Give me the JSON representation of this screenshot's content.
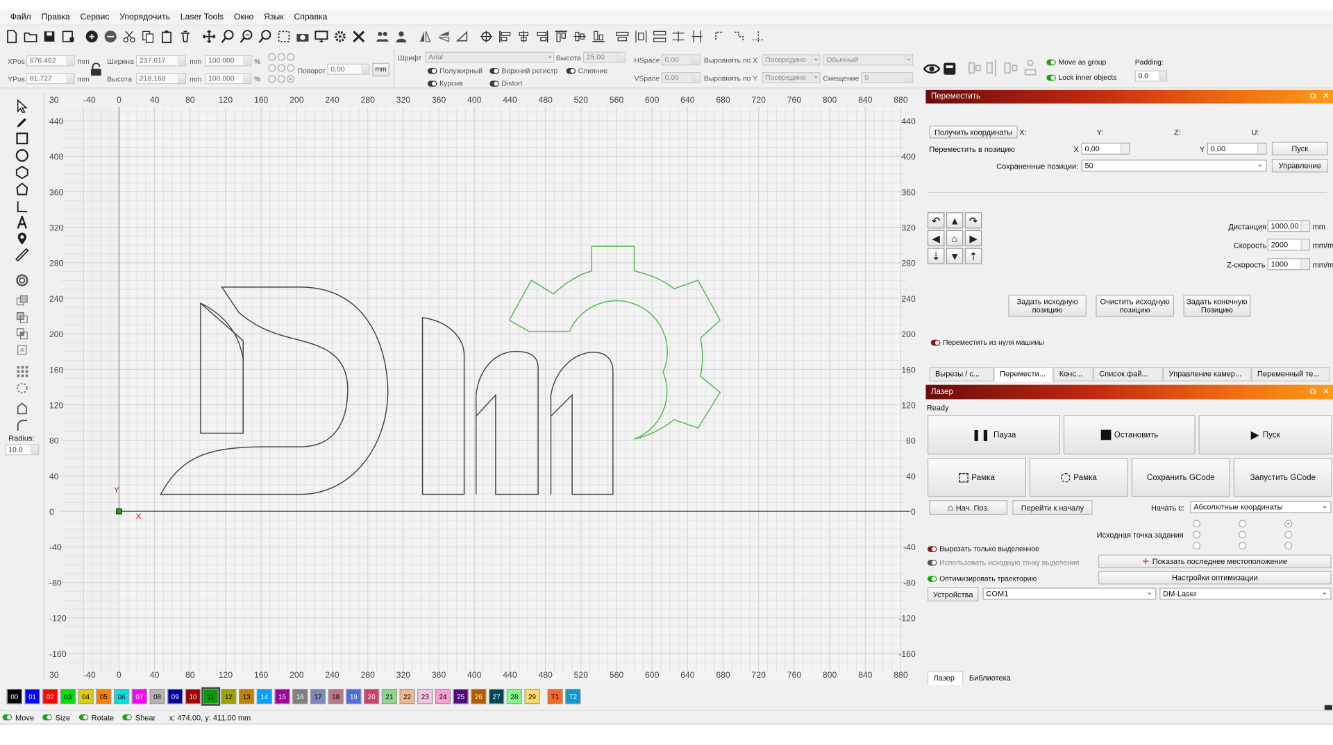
{
  "menu": [
    "Файл",
    "Правка",
    "Сервис",
    "Упорядочить",
    "Laser Tools",
    "Окно",
    "Язык",
    "Справка"
  ],
  "toolbar_icons": [
    "new-file-icon",
    "open-folder-icon",
    "save-icon",
    "save-as-icon",
    "import-icon",
    "export-icon",
    "cut-icon",
    "copy-icon",
    "paste-icon",
    "delete-icon",
    "move-icon",
    "zoom-in-icon",
    "zoom-out-icon",
    "zoom-fit-icon",
    "zoom-frame-icon",
    "camera-icon",
    "monitor-icon",
    "settings-icon",
    "tools-icon",
    "users-icon",
    "user-icon",
    "mirror-h-icon",
    "mirror-v-icon",
    "rotate-icon",
    "target-icon",
    "align-left-icon",
    "align-center-icon",
    "align-right-icon",
    "align-top-icon",
    "align-middle-icon",
    "align-bottom-icon",
    "distribute-h-icon",
    "distribute-v-icon",
    "distribute-icon",
    "spacing-icon",
    "spacing-v-icon",
    "corner-icon",
    "step-icon",
    "snap-icon"
  ],
  "props": {
    "xpos_label": "XPos",
    "xpos": "676.462",
    "ypos_label": "YPos",
    "ypos": "81.727",
    "width_label": "Ширина",
    "width": "237.617",
    "height_label": "Высота",
    "height": "218.168",
    "unit": "mm",
    "scale_w": "100.000",
    "scale_h": "100.000",
    "pct": "%",
    "rotate_label": "Поворот",
    "rotate": "0,00",
    "mm_btn": "mm",
    "font_label": "Шрифт",
    "font": "Arial",
    "font_h_label": "Высота",
    "font_h": "25.00",
    "bold": "Полужирный",
    "upper": "Верхний регистр",
    "weld": "Слияние",
    "italic": "Курсив",
    "distort": "Distort",
    "hspace_label": "HSpace",
    "hspace": "0.00",
    "vspace_label": "VSpace",
    "vspace": "0.00",
    "alignx_label": "Выровнять по X",
    "alignx": "Посередине",
    "aligny_label": "Выровнять по Y",
    "aligny": "Посередине",
    "normal": "Обычный",
    "offset_label": "Смещение",
    "offset": "0",
    "move_group": "Move as group",
    "lock_inner": "Lock inner objects",
    "padding_label": "Padding:",
    "padding": "0.0"
  },
  "left": {
    "radius_label": "Radius:",
    "radius": "10.0"
  },
  "ruler": {
    "top": [
      "30",
      "-40",
      "0",
      "40",
      "80",
      "120",
      "160",
      "200",
      "240",
      "280",
      "320",
      "360",
      "400",
      "440",
      "480",
      "520",
      "560",
      "600",
      "640",
      "680",
      "720",
      "760",
      "800",
      "840",
      "880"
    ],
    "left": [
      "440",
      "400",
      "360",
      "320",
      "280",
      "240",
      "200",
      "160",
      "120",
      "80",
      "40",
      "0",
      "-40",
      "-80",
      "-120",
      "-160"
    ]
  },
  "move_panel": {
    "title": "Переместить",
    "get_coords": "Получить координаты",
    "x": "X:",
    "y": "Y:",
    "z": "Z:",
    "u": "U:",
    "move_to": "Переместить в позицию",
    "xl": "X",
    "xv": "0,00",
    "yl": "Y",
    "yv": "0,00",
    "go": "Пуск",
    "saved_label": "Сохраненные позиции:",
    "saved": "50",
    "manage": "Управление",
    "distance_label": "Дистанция",
    "distance": "1000,00",
    "distance_unit": "mm",
    "speed_label": "Скорость",
    "speed": "2000",
    "speed_unit": "mm/m",
    "zspeed_label": "Z-скорость",
    "zspeed": "1000",
    "zspeed_unit": "mm/m",
    "set_origin": "Задать исходную позицию",
    "clear_origin": "Очистить исходную позицию",
    "set_end": "Задать конечную Позицию",
    "from_zero": "Переместить из нуля машины"
  },
  "tabs_top": [
    "Вырезы / с...",
    "Перемести...",
    "Конс...",
    "Список фай...",
    "Управление камер...",
    "Переменный те..."
  ],
  "laser": {
    "title": "Лазер",
    "status": "Ready",
    "pause": "Пауза",
    "stop": "Остановить",
    "start": "Пуск",
    "frame1": "Рамка",
    "frame2": "Рамка",
    "save_gcode": "Сохранить GCode",
    "run_gcode": "Запустить GCode",
    "home": "Нач. Поз.",
    "goto_origin": "Перейти к началу",
    "start_from_label": "Начать с:",
    "start_from": "Абсолютные координаты",
    "job_origin": "Исходная точка задания",
    "cut_selected": "Вырезать только выделенное",
    "use_origin": "Использовать исходную точку выделения",
    "show_last": "Показать последнее местоположение",
    "optimize": "Оптимизировать траекторию",
    "opt_settings": "Настройки оптимизации",
    "devices": "Устройства",
    "port": "COM1",
    "device": "DM-Laser"
  },
  "bottom_tabs": [
    "Лазер",
    "Библиотека"
  ],
  "palette": [
    {
      "n": "00",
      "c": "#000000",
      "t": "#ffffff"
    },
    {
      "n": "01",
      "c": "#0000ff",
      "t": "#ffffff"
    },
    {
      "n": "02",
      "c": "#ff0000",
      "t": "#ffffff"
    },
    {
      "n": "03",
      "c": "#00e000",
      "t": "#000000"
    },
    {
      "n": "04",
      "c": "#e0d000",
      "t": "#000000"
    },
    {
      "n": "05",
      "c": "#ff8000",
      "t": "#000000"
    },
    {
      "n": "06",
      "c": "#00e0e0",
      "t": "#000000"
    },
    {
      "n": "07",
      "c": "#ff00ff",
      "t": "#ffffff"
    },
    {
      "n": "08",
      "c": "#b4b4b4",
      "t": "#000000"
    },
    {
      "n": "09",
      "c": "#0000a0",
      "t": "#ffffff"
    },
    {
      "n": "10",
      "c": "#a00000",
      "t": "#ffffff"
    },
    {
      "n": "11",
      "c": "#00a000",
      "t": "#000000"
    },
    {
      "n": "12",
      "c": "#a0a000",
      "t": "#000000"
    },
    {
      "n": "13",
      "c": "#c08000",
      "t": "#000000"
    },
    {
      "n": "14",
      "c": "#00a0ff",
      "t": "#ffffff"
    },
    {
      "n": "15",
      "c": "#a000a0",
      "t": "#ffffff"
    },
    {
      "n": "16",
      "c": "#808080",
      "t": "#ffffff"
    },
    {
      "n": "17",
      "c": "#7d87b9",
      "t": "#000000"
    },
    {
      "n": "18",
      "c": "#bb7784",
      "t": "#000000"
    },
    {
      "n": "19",
      "c": "#4a6fe3",
      "t": "#ffffff"
    },
    {
      "n": "20",
      "c": "#d33f6a",
      "t": "#ffffff"
    },
    {
      "n": "21",
      "c": "#8cd78c",
      "t": "#000000"
    },
    {
      "n": "22",
      "c": "#f0b98d",
      "t": "#000000"
    },
    {
      "n": "23",
      "c": "#f6c4e1",
      "t": "#000000"
    },
    {
      "n": "24",
      "c": "#fa9ed4",
      "t": "#000000"
    },
    {
      "n": "25",
      "c": "#500a78",
      "t": "#ffffff"
    },
    {
      "n": "26",
      "c": "#b45a00",
      "t": "#ffffff"
    },
    {
      "n": "27",
      "c": "#004754",
      "t": "#ffffff"
    },
    {
      "n": "28",
      "c": "#86fa88",
      "t": "#000000"
    },
    {
      "n": "29",
      "c": "#ffdb66",
      "t": "#000000"
    },
    {
      "n": "T1",
      "c": "#f36926",
      "t": "#000000"
    },
    {
      "n": "T2",
      "c": "#0c97ce",
      "t": "#ffffff"
    }
  ],
  "status": {
    "move": "Move",
    "size": "Size",
    "rotate": "Rotate",
    "shear": "Shear",
    "coords": "x: 474.00, y: 411.00 mm"
  },
  "axis": {
    "x": "X",
    "y": "Y"
  }
}
